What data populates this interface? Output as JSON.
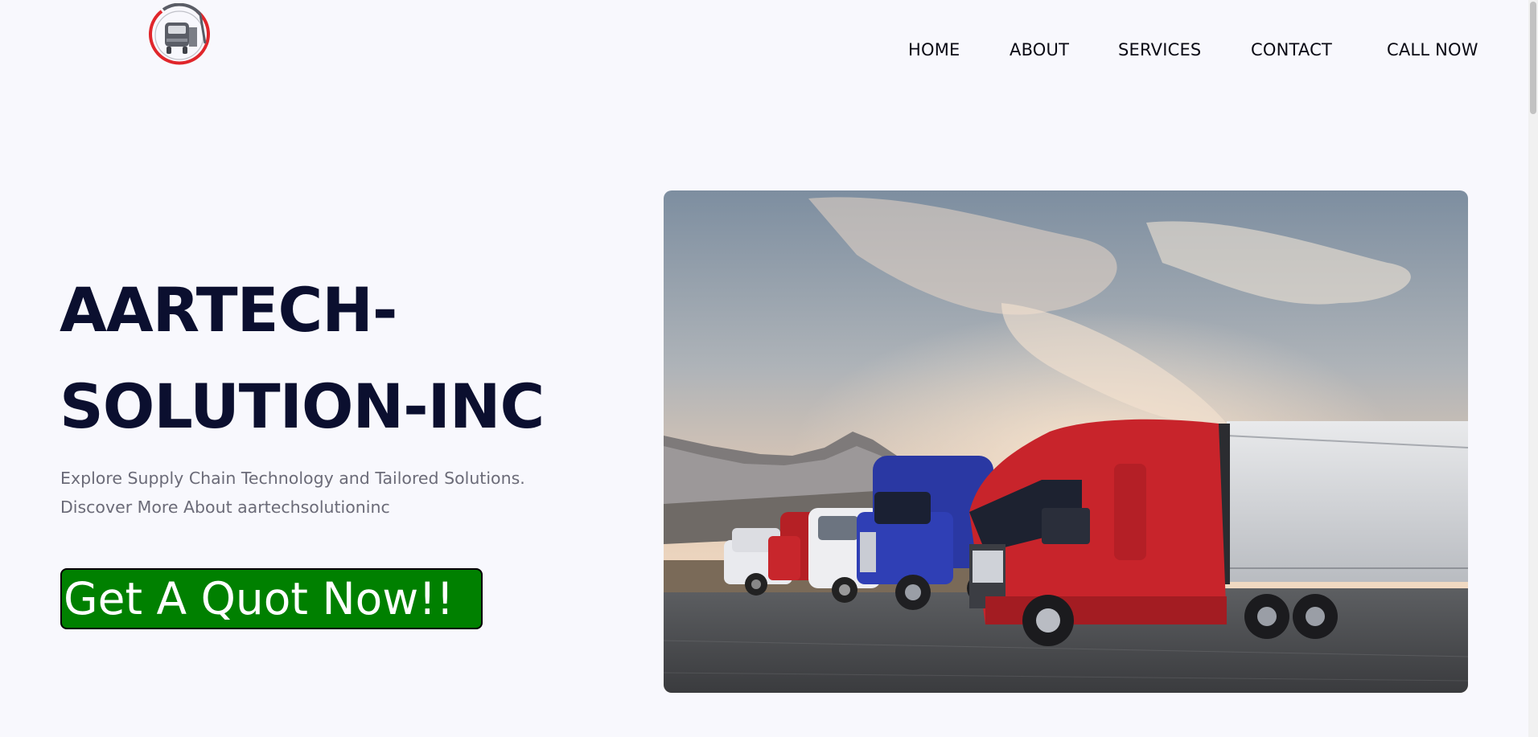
{
  "header": {
    "logo_icon": "truck-logo-icon",
    "nav": [
      {
        "label": "HOME"
      },
      {
        "label": "ABOUT"
      },
      {
        "label": "SERVICES"
      },
      {
        "label": "CONTACT"
      },
      {
        "label": "CALL NOW"
      }
    ]
  },
  "hero": {
    "title_line1": "AARTECH-",
    "title_line2": "SOLUTION-INC",
    "subtitle_line1": "Explore Supply Chain Technology and Tailored Solutions.",
    "subtitle_line2": "Discover More About aartechsolutioninc",
    "cta_label": "Get A Quot Now!!",
    "image_subject": "truck-fleet-image"
  },
  "colors": {
    "background": "#f8f8fd",
    "title": "#0b0f2f",
    "subtitle": "#6b6b78",
    "cta_background": "#008000",
    "cta_text": "#ffffff",
    "logo_red": "#e0262b",
    "logo_grey": "#5a5d66"
  }
}
